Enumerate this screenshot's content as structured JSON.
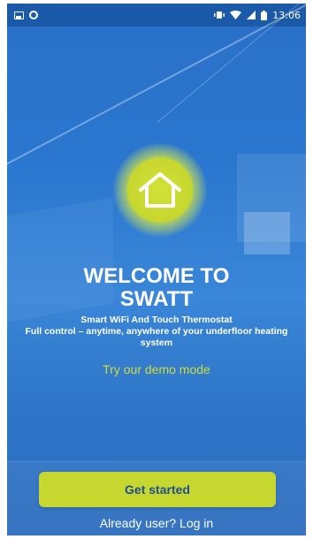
{
  "status_bar": {
    "left_icons": [
      "image-notification-icon",
      "circle-notification-icon"
    ],
    "right_icons": [
      "vibrate-icon",
      "wifi-icon",
      "signal-icon",
      "battery-icon"
    ],
    "time": "13:06"
  },
  "welcome": {
    "line1": "WELCOME TO",
    "line2": "SWATT",
    "subtitle_line1": "Smart WiFi And Touch Thermostat",
    "subtitle_line2": "Full control – anytime, anywhere of your underfloor heating system",
    "demo_link": "Try our demo mode"
  },
  "actions": {
    "get_started": "Get started",
    "login": "Already user? Log in"
  },
  "colors": {
    "background": "#2a77cf",
    "accent": "#c6d830",
    "button_text": "#1f4d8f",
    "demo_text": "#cddc3a"
  }
}
